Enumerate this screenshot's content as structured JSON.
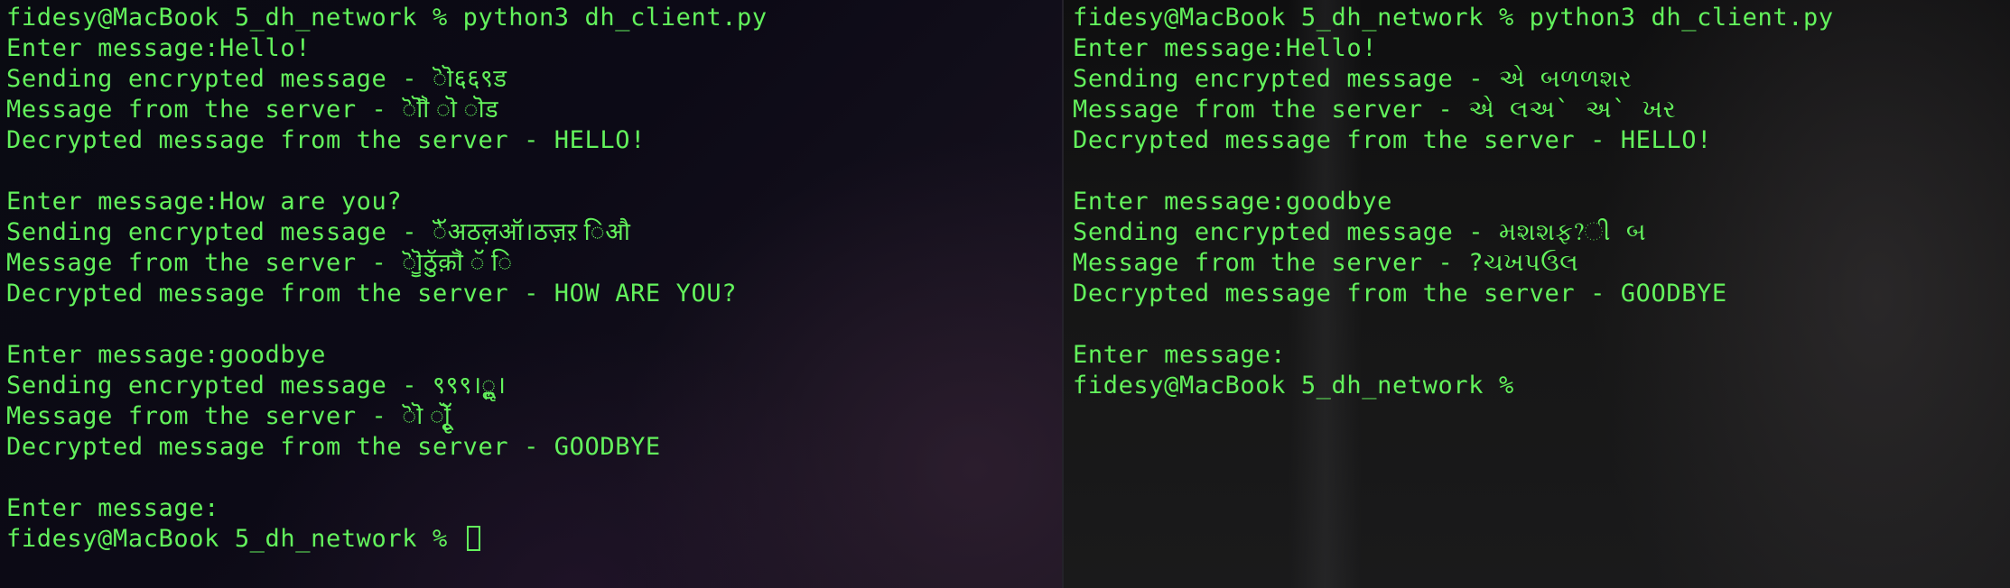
{
  "left_terminal": {
    "command_line": "fidesy@MacBook 5_dh_network % python3 dh_client.py",
    "exchanges": [
      {
        "prompt": "Enter message:Hello!",
        "sending": "Sending encrypted message - ॆॊ६६९ड",
        "server": "Message from the server - ॆॊॏ ॊ ॊड",
        "decrypted": "Decrypted message from the server - HELLO!"
      },
      {
        "prompt": "Enter message:How are you?",
        "sending": "Sending encrypted message - ॆॅअठल़ऑ।ठज़ऱ िऔ",
        "server": "Message from the server - ॆॊॗठुॅक़ॏ ॅ ि",
        "decrypted": "Decrypted message from the server - HOW ARE YOU?"
      },
      {
        "prompt": "Enter message:goodbye",
        "sending": "Sending encrypted message - ९९९।ॢू।",
        "server": "Message from the server - ॆॊ ॊॄूॅ",
        "decrypted": "Decrypted message from the server - GOODBYE"
      }
    ],
    "final_prompt": "Enter message:",
    "shell_prompt": "fidesy@MacBook 5_dh_network % "
  },
  "right_terminal": {
    "command_line": "fidesy@MacBook 5_dh_network % python3 dh_client.py",
    "exchanges": [
      {
        "prompt": "Enter message:Hello!",
        "sending": "Sending encrypted message - એ બળળશર",
        "server": "Message from the server - એ લઅ` અ` ખર",
        "decrypted": "Decrypted message from the server - HELLO!"
      },
      {
        "prompt": "Enter message:goodbye",
        "sending": "Sending encrypted message - મશશફ?ી બ",
        "server": "Message from the server - ?ચખપઉલ",
        "decrypted": "Decrypted message from the server - GOODBYE"
      }
    ],
    "final_prompt": "Enter message:",
    "shell_prompt": "fidesy@MacBook 5_dh_network %"
  },
  "colors": {
    "terminal_text": "#63f25c",
    "background": "#0b0a10"
  }
}
